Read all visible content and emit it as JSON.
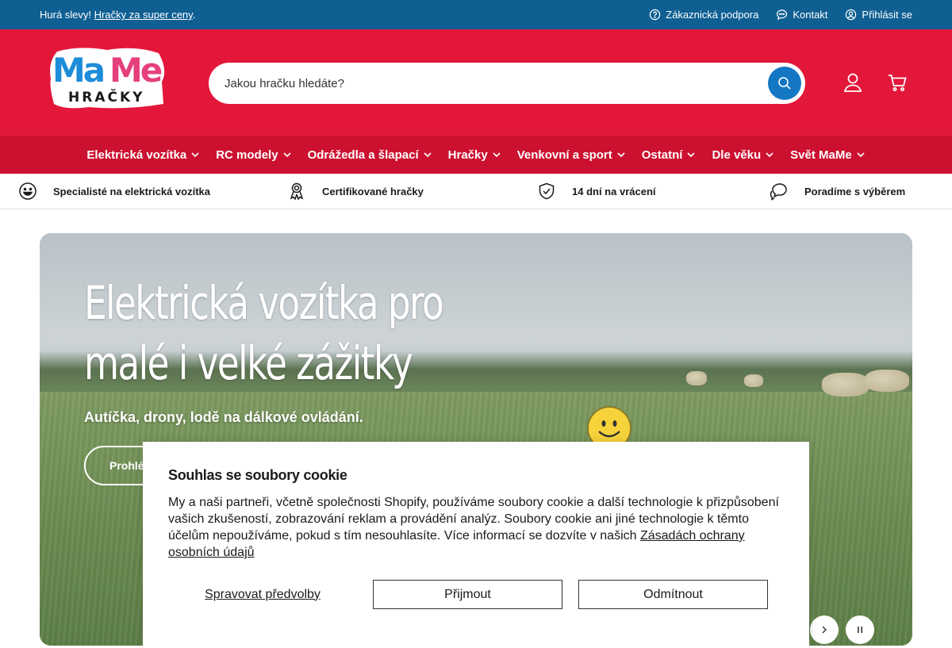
{
  "topbar": {
    "promo_text": "Hurá slevy!",
    "promo_link": "Hračky za super ceny",
    "promo_end": ".",
    "support": "Zákaznická podpora",
    "contact": "Kontakt",
    "login": "Přihlásit se"
  },
  "header": {
    "logo_top": "MaMe",
    "logo_bottom": "HRAČKY",
    "search_placeholder": "Jakou hračku hledáte?",
    "colors": {
      "brand_red": "#e3173a",
      "nav_red": "#cc1130",
      "topbar_blue": "#0f5f93",
      "search_blue": "#1477c4"
    }
  },
  "nav": {
    "items": [
      {
        "label": "Elektrická vozítka"
      },
      {
        "label": "RC modely"
      },
      {
        "label": "Odrážedla a šlapací"
      },
      {
        "label": "Hračky"
      },
      {
        "label": "Venkovní a sport"
      },
      {
        "label": "Ostatní"
      },
      {
        "label": "Dle věku"
      },
      {
        "label": "Svět MaMe"
      }
    ]
  },
  "usp": [
    {
      "icon": "smile-icon",
      "label": "Specialisté na elektrická vozítka"
    },
    {
      "icon": "award-icon",
      "label": "Certifikované hračky"
    },
    {
      "icon": "shield-check-icon",
      "label": "14 dní na vrácení"
    },
    {
      "icon": "chat-icon",
      "label": "Poradíme s výběrem"
    }
  ],
  "hero": {
    "title_line1": "Elektrická vozítka pro",
    "title_line2": "malé i velké zážitky",
    "subtitle": "Autíčka, drony, lodě na dálkové ovládání.",
    "cta": "Prohlé"
  },
  "cookie": {
    "title": "Souhlas se soubory cookie",
    "text": "My a naši partneři, včetně společnosti Shopify, používáme soubory cookie a další technologie k přizpůsobení vašich zkušeností, zobrazování reklam a provádění analýz. Soubory cookie ani jiné technologie k těmto účelům nepoužíváme, pokud s tím nesouhlasíte. Více informací se dozvíte v našich ",
    "link": "Zásadách ochrany osobních údajů",
    "manage": "Spravovat předvolby",
    "accept": "Přijmout",
    "decline": "Odmítnout"
  }
}
